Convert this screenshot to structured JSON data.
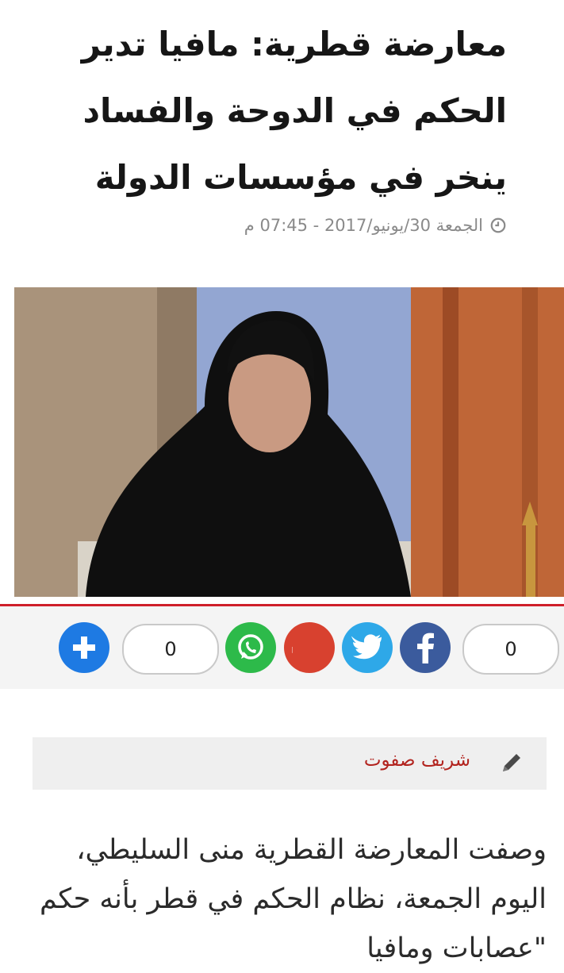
{
  "article": {
    "title": "معارضة قطرية: مافيا تدير الحكم في الدوحة والفساد ينخر في مؤسسات الدولة",
    "date": "الجمعة 30/يونيو/2017 - 07:45 م",
    "author": "شريف صفوت",
    "body": "وصفت المعارضة القطرية منى السليطي، اليوم الجمعة، نظام الحكم في قطر بأنه حكم \"عصابات ومافيا"
  },
  "share": {
    "left_count": "0",
    "right_count": "0",
    "buttons": [
      {
        "name": "add-icon",
        "color": "#1e7ae3"
      },
      {
        "name": "whatsapp-icon",
        "color": "#2dba4a"
      },
      {
        "name": "google-plus-icon",
        "color": "#d8412f"
      },
      {
        "name": "twitter-icon",
        "color": "#2ea8e8"
      },
      {
        "name": "facebook-icon",
        "color": "#3b5b9d"
      }
    ]
  },
  "colors": {
    "accent": "#cf1f2a",
    "author": "#b2231e"
  }
}
